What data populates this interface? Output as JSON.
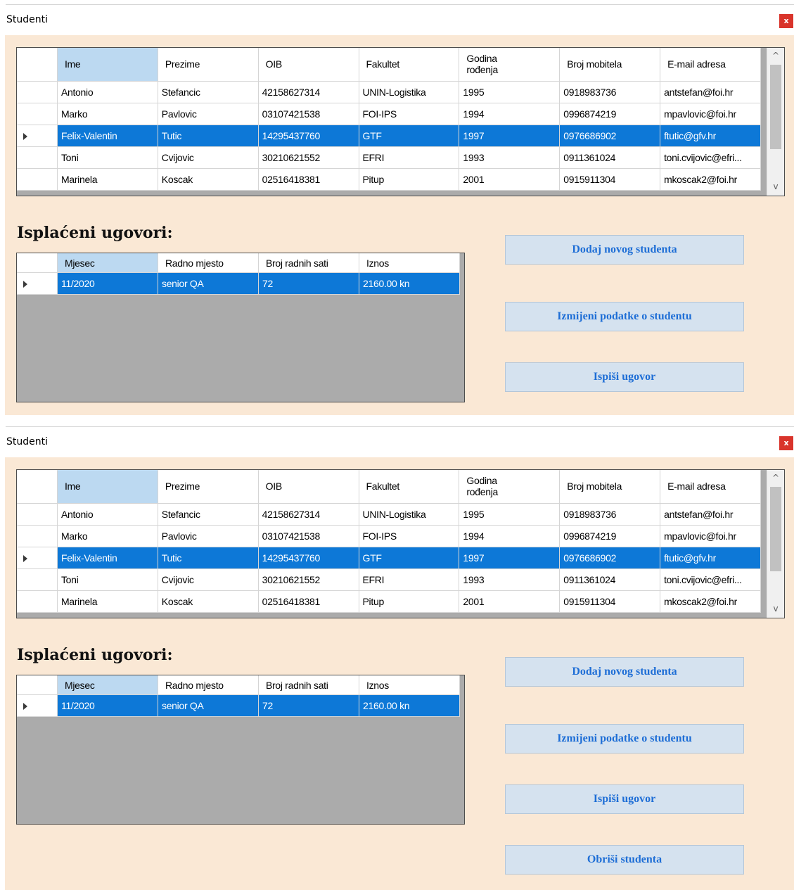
{
  "windows": [
    {
      "title": "Studenti",
      "close_label": "x",
      "students": {
        "columns": [
          "Ime",
          "Prezime",
          "OIB",
          "Fakultet",
          "Godina\nrođenja",
          "Broj mobitela",
          "E-mail adresa"
        ],
        "rows": [
          [
            "Antonio",
            "Stefancic",
            "42158627314",
            "UNIN-Logistika",
            "1995",
            "0918983736",
            "antstefan@foi.hr"
          ],
          [
            "Marko",
            "Pavlovic",
            "03107421538",
            "FOI-IPS",
            "1994",
            "0996874219",
            "mpavlovic@foi.hr"
          ],
          [
            "Felix-Valentin",
            "Tutic",
            "14295437760",
            "GTF",
            "1997",
            "0976686902",
            "ftutic@gfv.hr"
          ],
          [
            "Toni",
            "Cvijovic",
            "30210621552",
            "EFRI",
            "1993",
            "0911361024",
            "toni.cvijovic@efri..."
          ],
          [
            "Marinela",
            "Koscak",
            "02516418381",
            "Pitup",
            "2001",
            "0915911304",
            "mkoscak2@foi.hr"
          ]
        ],
        "selected_row": 2
      },
      "section_title": "Isplaćeni ugovori:",
      "contracts": {
        "columns": [
          "Mjesec",
          "Radno mjesto",
          "Broj radnih sati",
          "Iznos"
        ],
        "rows": [
          [
            "11/2020",
            "senior QA",
            "72",
            "2160.00 kn"
          ]
        ],
        "selected_row": 0
      },
      "buttons": [
        {
          "label": "Dodaj novog studenta"
        },
        {
          "label": "Izmijeni podatke o studentu"
        },
        {
          "label": "Ispiši ugovor"
        }
      ]
    },
    {
      "title": "Studenti",
      "close_label": "x",
      "students": {
        "columns": [
          "Ime",
          "Prezime",
          "OIB",
          "Fakultet",
          "Godina\nrođenja",
          "Broj mobitela",
          "E-mail adresa"
        ],
        "rows": [
          [
            "Antonio",
            "Stefancic",
            "42158627314",
            "UNIN-Logistika",
            "1995",
            "0918983736",
            "antstefan@foi.hr"
          ],
          [
            "Marko",
            "Pavlovic",
            "03107421538",
            "FOI-IPS",
            "1994",
            "0996874219",
            "mpavlovic@foi.hr"
          ],
          [
            "Felix-Valentin",
            "Tutic",
            "14295437760",
            "GTF",
            "1997",
            "0976686902",
            "ftutic@gfv.hr"
          ],
          [
            "Toni",
            "Cvijovic",
            "30210621552",
            "EFRI",
            "1993",
            "0911361024",
            "toni.cvijovic@efri..."
          ],
          [
            "Marinela",
            "Koscak",
            "02516418381",
            "Pitup",
            "2001",
            "0915911304",
            "mkoscak2@foi.hr"
          ]
        ],
        "selected_row": 2
      },
      "section_title": "Isplaćeni ugovori:",
      "contracts": {
        "columns": [
          "Mjesec",
          "Radno mjesto",
          "Broj radnih sati",
          "Iznos"
        ],
        "rows": [
          [
            "11/2020",
            "senior QA",
            "72",
            "2160.00 kn"
          ]
        ],
        "selected_row": 0
      },
      "buttons": [
        {
          "label": "Dodaj novog studenta"
        },
        {
          "label": "Izmijeni podatke o studentu"
        },
        {
          "label": "Ispiši ugovor"
        },
        {
          "label": "Obriši studenta"
        }
      ]
    }
  ],
  "scroll_up_glyph": "^",
  "scroll_down_glyph": "v"
}
